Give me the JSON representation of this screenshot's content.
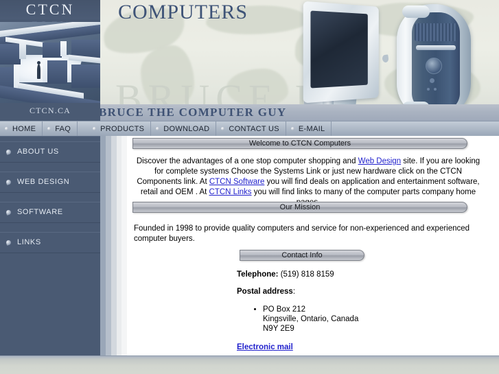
{
  "brand": {
    "logo": "CTCN",
    "logo_reflection": "CTCN",
    "domain": "CTCN.CA",
    "title": "COMPUTERS",
    "tagline": "BRUCE THE COMPUTER GUY",
    "watermark": "BRUCE D"
  },
  "colors": {
    "sidebar_bg": "#4a5a73",
    "nav_bg": "#aeb9c7",
    "title_blue": "#3e5377",
    "link_blue": "#2020cc",
    "banner_bg": "#e9eae2",
    "footer_bg": "#d2d6cf"
  },
  "topnav": {
    "items": [
      {
        "label": "HOME"
      },
      {
        "label": "FAQ"
      },
      {
        "label": "PRODUCTS"
      },
      {
        "label": "DOWNLOAD"
      },
      {
        "label": "CONTACT US"
      },
      {
        "label": "E-MAIL"
      }
    ]
  },
  "sidebar": {
    "items": [
      {
        "label": "ABOUT US"
      },
      {
        "label": "WEB DESIGN"
      },
      {
        "label": "SOFTWARE"
      },
      {
        "label": "LINKS"
      }
    ]
  },
  "content": {
    "welcome": {
      "heading": "Welcome to CTCN Computers",
      "text_1": "Discover the advantages of a one stop computer shopping and ",
      "link_1": "Web Design",
      "text_2": " site.   If you are looking for complete systems Choose the Systems Link or just new hardware click on the CTCN Components link.    At ",
      "link_2": "CTCN Software",
      "text_3": " you will find deals on application and entertainment software, retail and OEM .  At ",
      "link_3": "CTCN Links",
      "text_4": " you will find links to many of the computer parts company home pages."
    },
    "mission": {
      "heading": "Our Mission",
      "text": "Founded in 1998 to provide quality computers and service for non-experienced and experienced computer buyers."
    },
    "contact": {
      "heading": "Contact Info",
      "telephone_label": "Telephone:",
      "telephone_value": "(519) 818 8159",
      "postal_label": "Postal address",
      "postal_colon": ":",
      "address_lines": [
        "PO Box 212",
        "Kingsville, Ontario, Canada",
        "N9Y 2E9"
      ],
      "email_link": "Electronic mail"
    }
  }
}
